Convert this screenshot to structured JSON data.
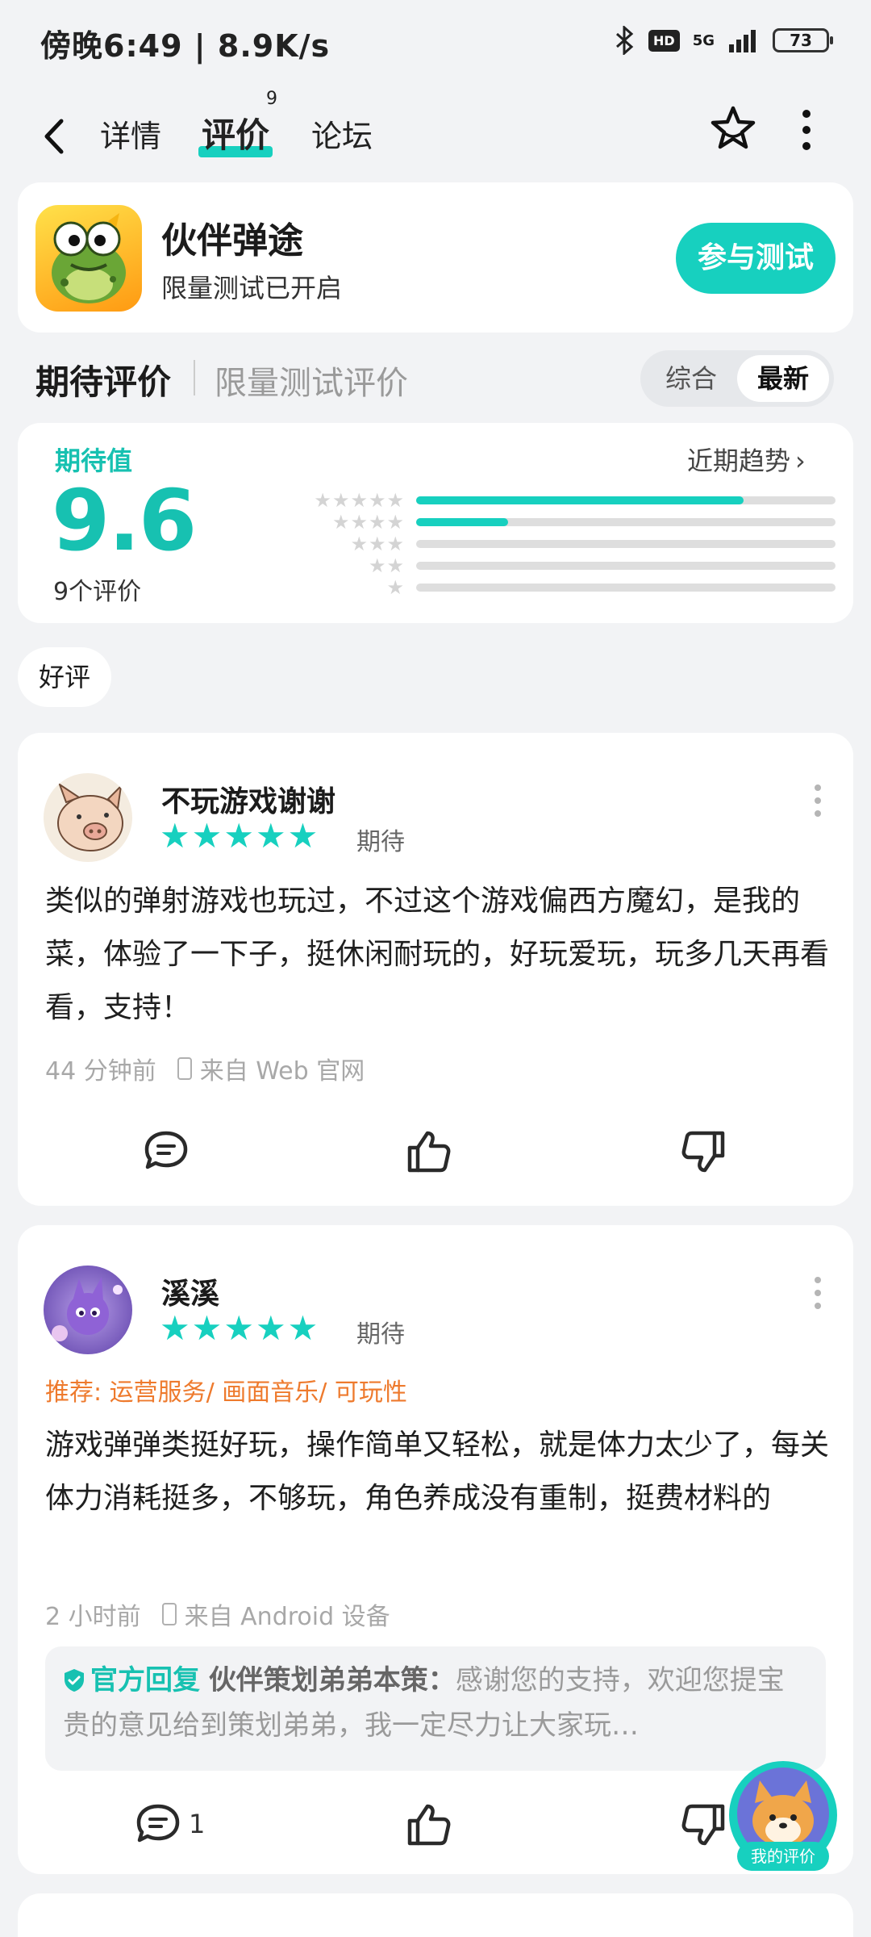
{
  "status_bar": {
    "time": "傍晚6:49",
    "speed": "8.9K/s",
    "hd": "HD",
    "network": "5G",
    "battery": "73"
  },
  "nav": {
    "tabs": [
      {
        "label": "详情"
      },
      {
        "label": "评价",
        "badge": "9"
      },
      {
        "label": "论坛"
      }
    ],
    "active_tab": "评价"
  },
  "app": {
    "name": "伙伴弹途",
    "subtitle": "限量测试已开启",
    "join_label": "参与测试"
  },
  "section": {
    "title": "期待评价",
    "title2": "限量测试评价",
    "sort_options": [
      "综合",
      "最新"
    ],
    "sort_selected": "最新"
  },
  "score": {
    "label": "期待值",
    "value": "9.6",
    "count": "9个评价",
    "trend_label": "近期趋势",
    "distribution": [
      {
        "stars": 5,
        "fraction": 0.78
      },
      {
        "stars": 4,
        "fraction": 0.22
      },
      {
        "stars": 3,
        "fraction": 0
      },
      {
        "stars": 2,
        "fraction": 0
      },
      {
        "stars": 1,
        "fraction": 0
      }
    ]
  },
  "filter_chip": "好评",
  "reviews": [
    {
      "user": "不玩游戏谢谢",
      "rating": 5,
      "tag": "期待",
      "text": "类似的弹射游戏也玩过，不过这个游戏偏西方魔幻，是我的菜，体验了一下子，挺休闲耐玩的，好玩爱玩，玩多几天再看看，支持！",
      "time": "44 分钟前",
      "source": "来自 Web 官网"
    },
    {
      "user": "溪溪",
      "rating": 5,
      "tag": "期待",
      "recommend": "推荐: 运营服务/ 画面音乐/ 可玩性",
      "text": "游戏弹弹类挺好玩，操作简单又轻松，就是体力太少了，每关体力消耗挺多，不够玩，角色养成没有重制，挺费材料的",
      "time": "2 小时前",
      "source": "来自 Android 设备",
      "reply": {
        "official_label": "官方回复",
        "author": "伙伴策划弟弟本策：",
        "text": "感谢您的支持，欢迎您提宝贵的意见给到策划弟弟，我一定尽力让大家玩…"
      },
      "comment_count": "1"
    }
  ],
  "my_review_label": "我的评价",
  "colors": {
    "accent": "#17d0bf",
    "recommend": "#ee7a2d",
    "background": "#f2f3f5"
  }
}
